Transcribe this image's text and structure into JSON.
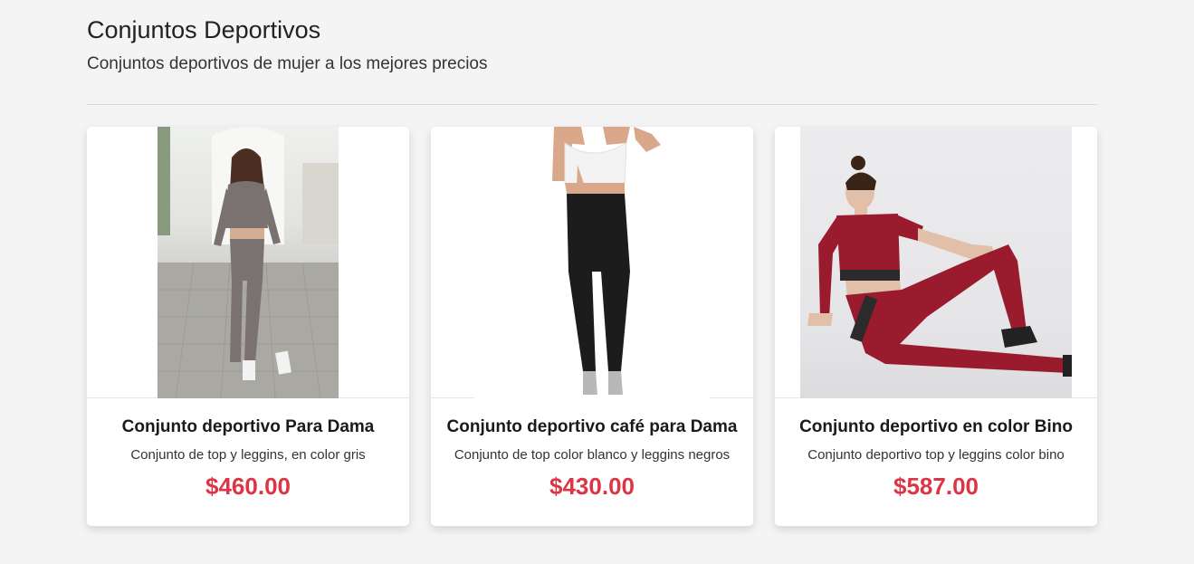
{
  "header": {
    "title": "Conjuntos Deportivos",
    "subtitle": "Conjuntos deportivos de mujer a los mejores precios"
  },
  "products": [
    {
      "title": "Conjunto deportivo Para Dama",
      "description": "Conjunto de top y leggins, en color gris",
      "price": "$460.00",
      "outfit_color": "#7a7270"
    },
    {
      "title": "Conjunto deportivo café para Dama",
      "description": "Conjunto de top color blanco y leggins negros",
      "price": "$430.00",
      "outfit_color": "#1c1c1c"
    },
    {
      "title": "Conjunto deportivo en color Bino",
      "description": "Conjunto deportivo top y leggins color bino",
      "price": "$587.00",
      "outfit_color": "#9b1b2e"
    }
  ],
  "colors": {
    "price": "#dc3545",
    "background": "#f4f4f4"
  }
}
